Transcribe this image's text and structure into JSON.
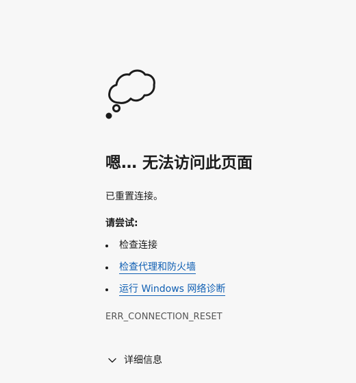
{
  "error_page": {
    "icon": "thought-cloud-icon",
    "title": "嗯… 无法访问此页面",
    "subtitle": "已重置连接。",
    "try_heading": "请尝试:",
    "suggestions": [
      {
        "label": "检查连接",
        "is_link": false
      },
      {
        "label": "检查代理和防火墙",
        "is_link": true
      },
      {
        "label": "运行 Windows 网络诊断",
        "is_link": true
      }
    ],
    "error_code": "ERR_CONNECTION_RESET",
    "details_label": "详细信息",
    "details_icon": "chevron-down-icon",
    "colors": {
      "background": "#f7f7f7",
      "text": "#1b1b1b",
      "link": "#0f5fb3",
      "muted": "#555555"
    }
  }
}
